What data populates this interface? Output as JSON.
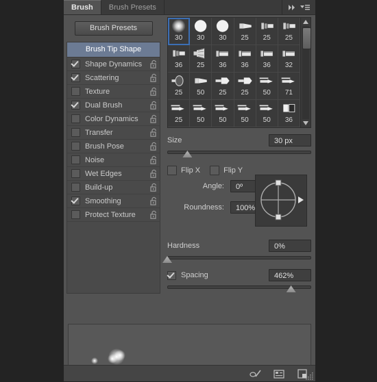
{
  "panel": {
    "tabs": [
      {
        "label": "Brush",
        "active": true
      },
      {
        "label": "Brush Presets",
        "active": false
      }
    ],
    "collapse_icon": "double-chevron-right-icon",
    "menu_icon": "panel-menu-icon",
    "presets_button": "Brush Presets"
  },
  "options": {
    "header": "Brush Tip Shape",
    "items": [
      {
        "label": "Shape Dynamics",
        "checked": true,
        "lock": "unlocked-padlock-icon"
      },
      {
        "label": "Scattering",
        "checked": true,
        "lock": "unlocked-padlock-icon"
      },
      {
        "label": "Texture",
        "checked": false,
        "lock": "unlocked-padlock-icon"
      },
      {
        "label": "Dual Brush",
        "checked": true,
        "lock": "unlocked-padlock-icon"
      },
      {
        "label": "Color Dynamics",
        "checked": false,
        "lock": "unlocked-padlock-icon"
      },
      {
        "label": "Transfer",
        "checked": false,
        "lock": "unlocked-padlock-icon"
      },
      {
        "label": "Brush Pose",
        "checked": false,
        "lock": "unlocked-padlock-icon"
      },
      {
        "label": "Noise",
        "checked": false,
        "lock": "unlocked-padlock-icon"
      },
      {
        "label": "Wet Edges",
        "checked": false,
        "lock": "unlocked-padlock-icon"
      },
      {
        "label": "Build-up",
        "checked": false,
        "lock": "unlocked-padlock-icon"
      },
      {
        "label": "Smoothing",
        "checked": true,
        "lock": "unlocked-padlock-icon"
      },
      {
        "label": "Protect Texture",
        "checked": false,
        "lock": "unlocked-padlock-icon"
      }
    ]
  },
  "brush_grid": {
    "selected_index": 0,
    "scroll_up_icon": "scroll-up-arrow-icon",
    "scroll_down_icon": "scroll-down-arrow-icon",
    "tips": [
      {
        "size": "30",
        "shape": "soft-round"
      },
      {
        "size": "30",
        "shape": "hard-round"
      },
      {
        "size": "30",
        "shape": "hard-round"
      },
      {
        "size": "25",
        "shape": "flat-angle"
      },
      {
        "size": "25",
        "shape": "flat-block"
      },
      {
        "size": "25",
        "shape": "flat-block"
      },
      {
        "size": "36",
        "shape": "flat-block"
      },
      {
        "size": "25",
        "shape": "fan"
      },
      {
        "size": "36",
        "shape": "flat-wide"
      },
      {
        "size": "36",
        "shape": "flat-wide"
      },
      {
        "size": "36",
        "shape": "flat-wide"
      },
      {
        "size": "32",
        "shape": "flat-wide"
      },
      {
        "size": "25",
        "shape": "round-fan"
      },
      {
        "size": "50",
        "shape": "flat-angle"
      },
      {
        "size": "25",
        "shape": "chisel"
      },
      {
        "size": "25",
        "shape": "chisel"
      },
      {
        "size": "50",
        "shape": "thin-chisel"
      },
      {
        "size": "71",
        "shape": "thin-chisel"
      },
      {
        "size": "25",
        "shape": "thin-chisel"
      },
      {
        "size": "50",
        "shape": "thin-chisel"
      },
      {
        "size": "50",
        "shape": "thin-chisel"
      },
      {
        "size": "50",
        "shape": "thin-chisel"
      },
      {
        "size": "50",
        "shape": "thin-chisel"
      },
      {
        "size": "36",
        "shape": "square-block"
      },
      {
        "size": "",
        "shape": "thin-chisel"
      },
      {
        "size": "",
        "shape": "thin-chisel"
      },
      {
        "size": "",
        "shape": "chisel"
      },
      {
        "size": "",
        "shape": "chisel"
      },
      {
        "size": "",
        "shape": "chisel"
      },
      {
        "size": "",
        "shape": "chisel"
      }
    ]
  },
  "controls": {
    "size": {
      "label": "Size",
      "value": "30 px",
      "slider_percent": 14
    },
    "flip_x": {
      "label": "Flip X",
      "checked": false
    },
    "flip_y": {
      "label": "Flip Y",
      "checked": false
    },
    "angle": {
      "label": "Angle:",
      "value": "0º"
    },
    "roundness": {
      "label": "Roundness:",
      "value": "100%"
    },
    "hardness": {
      "label": "Hardness",
      "value": "0%",
      "slider_percent": 0
    },
    "spacing": {
      "label": "Spacing",
      "value": "462%",
      "checked": true,
      "slider_percent": 86
    }
  },
  "footer": {
    "icons": [
      {
        "name": "brush-toggle-icon"
      },
      {
        "name": "preset-panel-icon"
      },
      {
        "name": "new-brush-icon"
      }
    ],
    "resize_grip": "resize-grip-icon"
  }
}
